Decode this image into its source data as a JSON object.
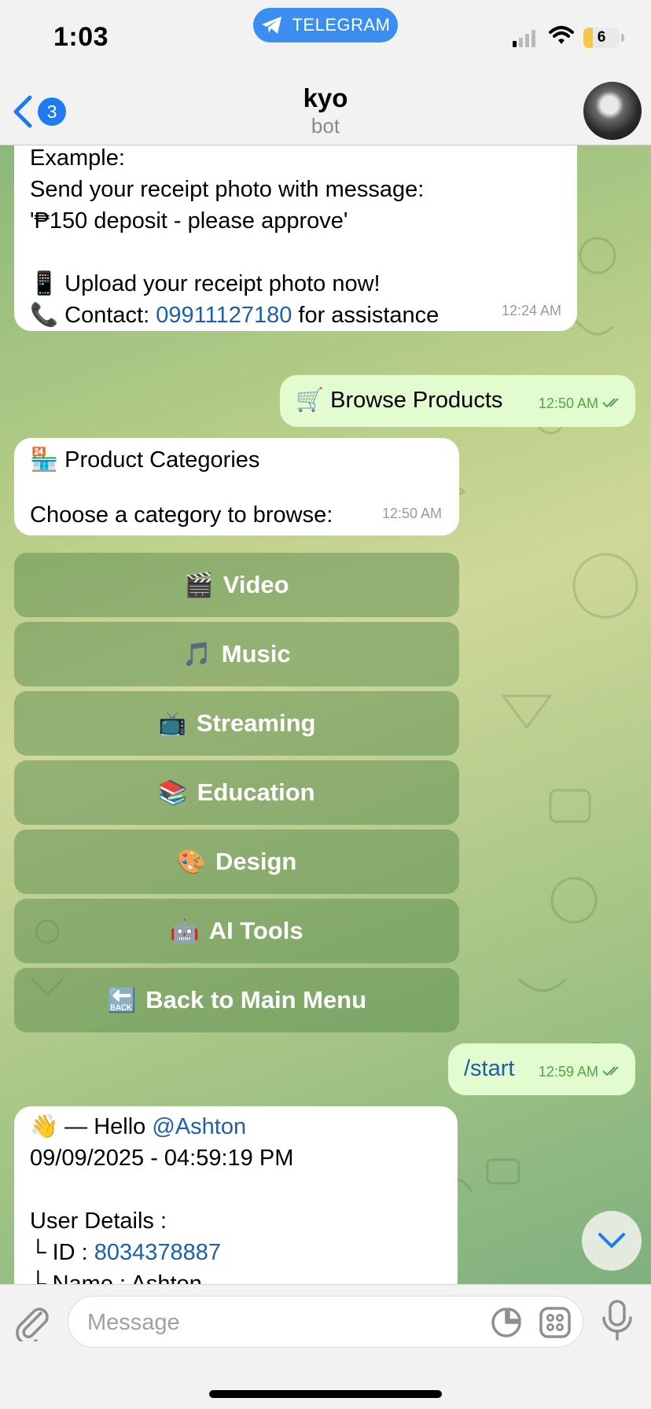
{
  "status_bar": {
    "time": "1:03",
    "app_pill": "TELEGRAM",
    "battery": "6"
  },
  "header": {
    "back_count": "3",
    "title": "kyo",
    "subtitle": "bot"
  },
  "messages": {
    "m1": {
      "lines": [
        "Example:",
        "Send your receipt photo with message:",
        "'₱150 deposit - please approve'"
      ],
      "upload_emoji": "📱",
      "upload_text": "Upload your receipt photo now!",
      "contact_emoji": "📞",
      "contact_prefix": "Contact: ",
      "contact_phone": "09911127180",
      "contact_suffix": " for assistance",
      "time": "12:24 AM"
    },
    "m2": {
      "emoji": "🛒",
      "text": "Browse Products",
      "time": "12:50 AM"
    },
    "m3": {
      "emoji": "🏪",
      "title": "Product Categories",
      "prompt": "Choose a category to browse:",
      "time": "12:50 AM"
    },
    "m4": {
      "text": "/start",
      "time": "12:59 AM"
    },
    "m5": {
      "emoji": "👋",
      "greeting": " — Hello ",
      "handle": "@Ashton",
      "datetime": "09/09/2025 - 04:59:19 PM",
      "details_label": "User Details :",
      "id_label": "└ ID : ",
      "id_value": "8034378887",
      "name_row": "├ Name : Ashton"
    }
  },
  "keyboard": [
    {
      "emoji": "🎬",
      "label": "Video"
    },
    {
      "emoji": "🎵",
      "label": "Music"
    },
    {
      "emoji": "📺",
      "label": "Streaming"
    },
    {
      "emoji": "📚",
      "label": "Education"
    },
    {
      "emoji": "🎨",
      "label": "Design"
    },
    {
      "emoji": "🤖",
      "label": "AI Tools"
    },
    {
      "emoji": "🔙",
      "label": "Back to Main Menu"
    }
  ],
  "composer": {
    "placeholder": "Message"
  },
  "colors": {
    "accent": "#1f7bf0",
    "outgoing_bubble": "#e2fbcf",
    "link": "#1f5fa6",
    "read_check": "#52a64a"
  }
}
